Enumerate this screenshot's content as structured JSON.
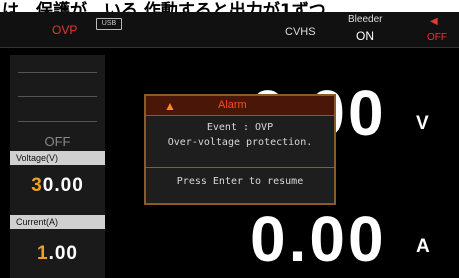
{
  "caption": "は、保護が…いる 作動すると出力が1ずつ",
  "status": {
    "protection": "OVP",
    "usb_label": "USB",
    "mode": "CVHS",
    "bleeder_label": "Bleeder",
    "bleeder_value": "ON",
    "speaker_icon": "speaker-icon",
    "sound_state": "OFF"
  },
  "sidebar": {
    "output_state": "OFF",
    "voltage_header": "Voltage(V)",
    "voltage_setting_first": "3",
    "voltage_setting_rest": "0.00",
    "current_header": "Current(A)",
    "current_setting_first": "1",
    "current_setting_rest": ".00"
  },
  "readout": {
    "voltage": "0.00",
    "voltage_unit": "V",
    "current": "0.00",
    "current_unit": "A"
  },
  "alarm": {
    "title": "Alarm",
    "icon": "warning-icon",
    "event": "Event : OVP",
    "description": "Over-voltage protection.",
    "footer": "Press Enter to resume"
  },
  "colors": {
    "alarm_red": "#e23a2e",
    "highlight_orange": "#f0a020",
    "dialog_border": "#8a5a28"
  }
}
